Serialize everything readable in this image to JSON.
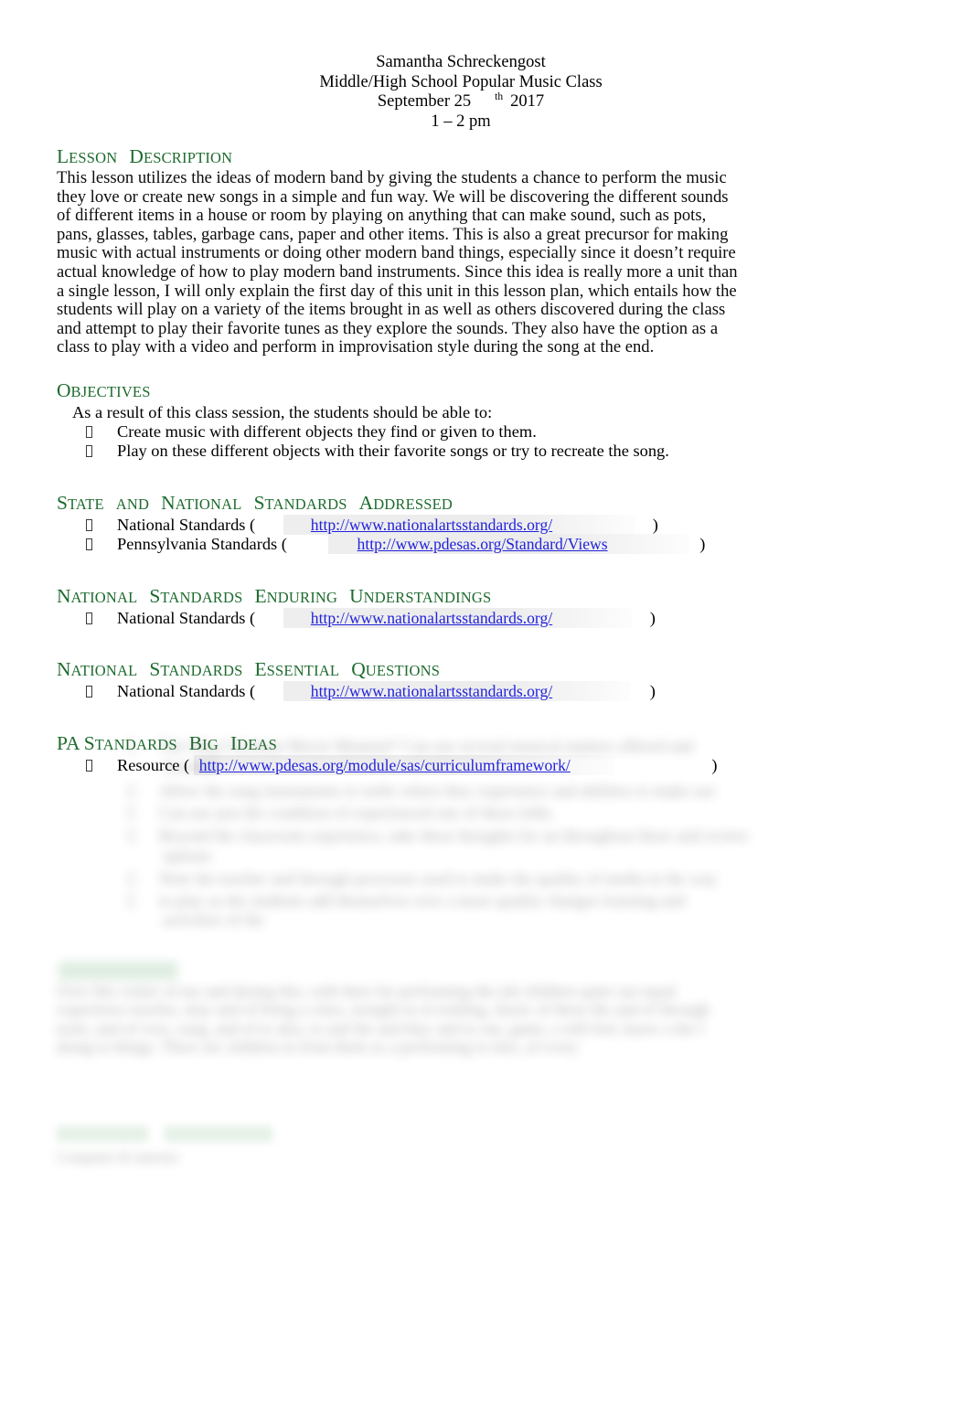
{
  "document": {
    "header": {
      "author": "Samantha Schreckengost",
      "course": "Middle/High School Popular Music Class",
      "date_month_day": "September 25",
      "date_ordinal": "th",
      "date_year": "2017",
      "time": "1 – 2 pm"
    },
    "sections": [
      {
        "id": "lesson-description",
        "heading_words": [
          "Lesson",
          "Description"
        ],
        "body": "This lesson utilizes the ideas of modern band by giving the students a chance to perform the music they love or create new songs in a simple and fun way. We will be discovering the different sounds of different items in a house or room by playing on anything that can make sound, such as pots, pans, glasses, tables, garbage cans, paper and other items. This is also a great precursor for making music with actual instruments or doing other modern band things, especially since it doesn’t require actual knowledge of how to play modern band instruments. Since this idea is really more a unit than a single lesson, I will only explain the first day of this unit in this lesson plan, which entails how the students will play on a variety of the items brought in as well as others discovered during the class and attempt to play their favorite tunes as they explore the sounds. They also have the option as a class to play with a video and perform in improvisation style during the song at the end."
      },
      {
        "id": "objectives",
        "heading_words": [
          "Objectives"
        ],
        "intro": "As a result of this class session, the students should be able to:",
        "items": [
          "Create music with different objects they find or given to them.",
          "Play on these different objects with their favorite songs or try to recreate the song."
        ]
      },
      {
        "id": "state-and-national-standards-addressed",
        "heading_words": [
          "State",
          "and",
          "National",
          "Standards",
          "Addressed"
        ],
        "links": [
          {
            "label": "National Standards (",
            "url": "http://www.nationalartsstandards.org/",
            "close": ")"
          },
          {
            "label": "Pennsylvania Standards (",
            "url": "http://www.pdesas.org/Standard/Views",
            "close": ")"
          }
        ]
      },
      {
        "id": "national-standards-enduring-understandings",
        "heading_words": [
          "National",
          "Standards",
          "Enduring",
          "Understandings"
        ],
        "links": [
          {
            "label": "National Standards (",
            "url": "http://www.nationalartsstandards.org/",
            "close": ")"
          }
        ]
      },
      {
        "id": "national-standards-essential-questions",
        "heading_words": [
          "National",
          "Standards",
          "Essential",
          "Questions"
        ],
        "links": [
          {
            "label": "National Standards (",
            "url": "http://www.nationalartsstandards.org/",
            "close": ")"
          }
        ]
      },
      {
        "id": "pa-standards-big-ideas",
        "heading_words": [
          "PA Standards",
          "Big",
          "Ideas"
        ],
        "links": [
          {
            "label": "Resource (",
            "url": "http://www.pdesas.org/module/sas/curriculumframework/",
            "close": ")"
          }
        ]
      }
    ],
    "obscured": {
      "note": "blurred-illegible",
      "bullet_count": 6,
      "green_heading_count": 2
    }
  },
  "colors": {
    "heading_green": "#1e6b2e",
    "link_blue": "#2222dd",
    "body_text": "#0c0c0c",
    "field_shade": "#ececec",
    "page_background": "#ffffff"
  }
}
